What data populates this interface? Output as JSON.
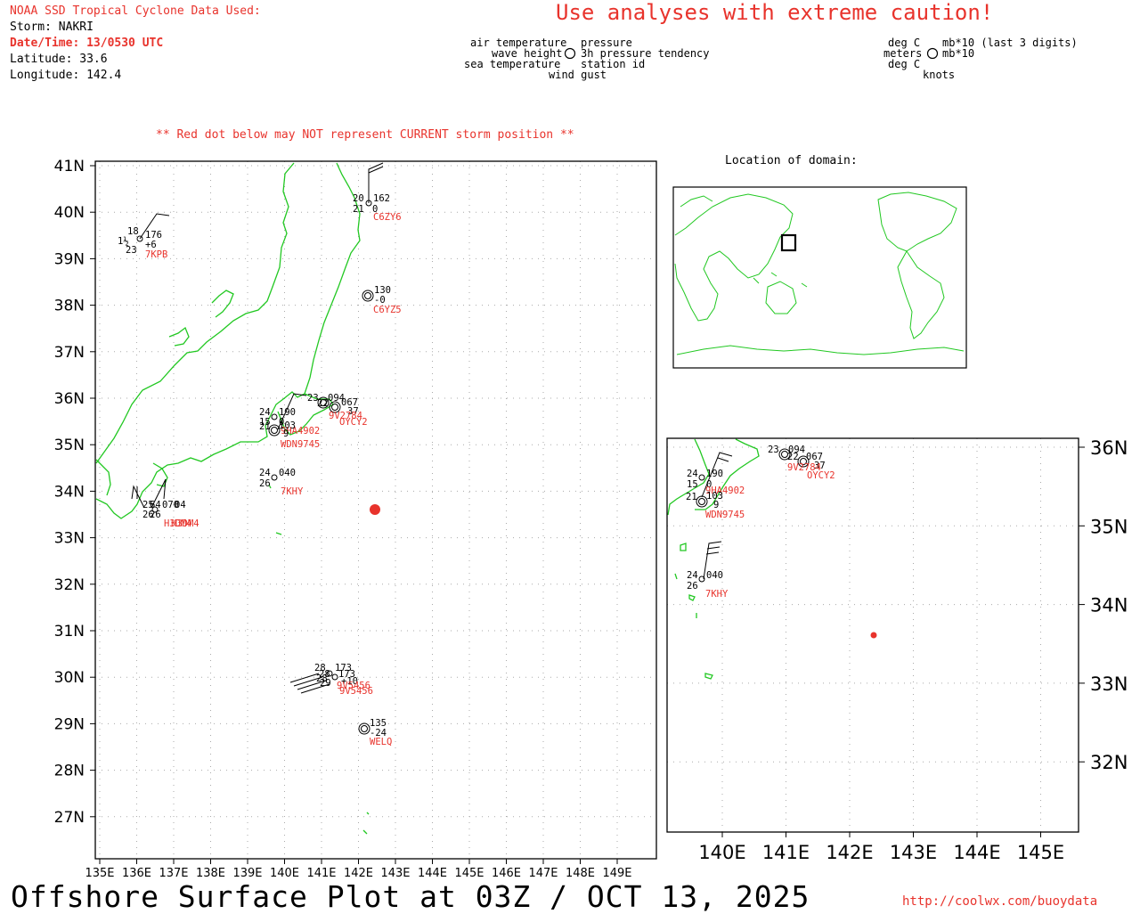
{
  "header": {
    "source_line": "NOAA SSD Tropical Cyclone Data Used:",
    "storm_line": "Storm: NAKRI",
    "datetime_line": "Date/Time: 13/0530 UTC",
    "latitude_line": "Latitude: 33.6",
    "longitude_line": "Longitude: 142.4",
    "caution": "Use analyses with extreme caution!",
    "red_dot_warning": "** Red dot below may NOT represent CURRENT storm position **"
  },
  "legend": {
    "air_temperature": "air temperature",
    "wave_height": "wave height",
    "sea_temperature": "sea temperature",
    "wind_gust": "wind gust",
    "pressure": "pressure",
    "pressure_tendency": "3h pressure tendency",
    "station_id": "station id",
    "unit_deg_c_1": "deg C",
    "unit_meters": "meters",
    "unit_deg_c_2": "deg C",
    "unit_pressure": "mb*10 (last 3 digits)",
    "unit_tendency": "mb*10",
    "unit_knots": "knots"
  },
  "inset": {
    "title": "Location of domain:"
  },
  "main_map": {
    "lat_labels": [
      "41N",
      "40N",
      "39N",
      "38N",
      "37N",
      "36N",
      "35N",
      "34N",
      "33N",
      "32N",
      "31N",
      "30N",
      "29N",
      "28N",
      "27N"
    ],
    "lon_labels": [
      "135E",
      "136E",
      "137E",
      "138E",
      "139E",
      "140E",
      "141E",
      "142E",
      "143E",
      "144E",
      "145E",
      "146E",
      "147E",
      "148E",
      "149E"
    ]
  },
  "zoom_map": {
    "lat_labels": [
      "36N",
      "35N",
      "34N",
      "33N",
      "32N"
    ],
    "lon_labels": [
      "140E",
      "141E",
      "142E",
      "143E",
      "144E",
      "145E"
    ]
  },
  "stations": [
    {
      "id": "C6ZY6",
      "lines": [
        [
          "20",
          "162"
        ],
        [
          "21",
          "0"
        ]
      ]
    },
    {
      "id": "7KPB",
      "lines": [
        [
          "18",
          "176"
        ],
        [
          "1½",
          "+6"
        ],
        [
          "23",
          ""
        ]
      ]
    },
    {
      "id": "C6YZ5",
      "lines": [
        [
          "",
          "130"
        ],
        [
          "",
          "-0"
        ]
      ]
    },
    {
      "id": "9V2784",
      "lines": [
        [
          "23",
          "094"
        ],
        [
          "22",
          "067"
        ],
        [
          "",
          "37"
        ]
      ]
    },
    {
      "id": "OYCY2",
      "lines": []
    },
    {
      "id": "9HA4902",
      "lines": [
        [
          "24",
          "190"
        ],
        [
          "15",
          "0"
        ]
      ]
    },
    {
      "id": "WDN9745",
      "lines": [
        [
          "21",
          "103"
        ],
        [
          "",
          "9"
        ]
      ]
    },
    {
      "id": "7KHY",
      "lines": [
        [
          "24",
          "040"
        ],
        [
          "26",
          ""
        ]
      ]
    },
    {
      "id": "H3DM4",
      "lines": [
        [
          "25",
          "070"
        ],
        [
          "26",
          "04"
        ]
      ]
    },
    {
      "id": "9V5456",
      "lines": [
        [
          "28",
          "173"
        ],
        [
          "28",
          "173"
        ],
        [
          "29",
          "+10"
        ]
      ]
    },
    {
      "id": "WELQ",
      "lines": [
        [
          "",
          "135"
        ],
        [
          "",
          "-24"
        ]
      ]
    }
  ],
  "footer": {
    "title": "Offshore Surface Plot at 03Z / OCT 13, 2025",
    "url": "http://coolwx.com/buoydata"
  },
  "colors": {
    "land": "#22c822",
    "accent": "#e8332c",
    "grid": "#aaaaaa",
    "frame": "#000000"
  }
}
